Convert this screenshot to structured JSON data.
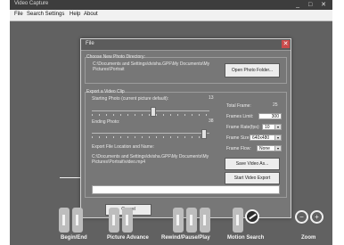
{
  "window": {
    "title": "Video Capture",
    "controls": "_ □ ✕"
  },
  "menu": {
    "file": "File",
    "search_settings": "Search Settings",
    "help": "Help",
    "about": "About"
  },
  "dialog": {
    "title": "File",
    "close_glyph": "✕",
    "photo_dir": {
      "label": "Choose New Photo Directory:",
      "path": "C:\\Documents and Settings\\dvisha.GPF\\My Documents\\My Pictures\\Portrait",
      "open_button": "Open Photo Folder..."
    },
    "video_clip": {
      "label": "Export a Video Clip",
      "start_label": "Starting Photo (current picture default):",
      "start_value": "13",
      "start_position": 0.52,
      "end_label": "Ending Photo:",
      "end_value": "38",
      "end_position": 0.98,
      "export_label": "Export File Location and Name:",
      "export_path": "C:\\Documents and Settings\\dvisha.GPF\\My Documents\\My Pictures\\Portrait\\video.mp4",
      "total_frames_label": "Total Frame:",
      "total_frames_value": "25",
      "frames_limit_label": "Frames Limit:",
      "frames_limit_value": "300",
      "frame_rate_label": "Frame Rate(fps):",
      "frame_rate_value": "10",
      "frame_size_label": "Frame Size:",
      "frame_size_value": "640x480",
      "frame_flow_label": "Frame Flow:",
      "frame_flow_value": "None",
      "save_button": "Save Video As...",
      "start_button": "Start Video Export",
      "cancel_button": "Cancel"
    }
  },
  "toolbar": {
    "begin_end": "Begin/End",
    "picture_advance": "Picture Advance",
    "rewind_pause_play": "Rewind/Pause/Play",
    "motion_search": "Motion Search",
    "zoom": "Zoom",
    "zoom_out_glyph": "−",
    "zoom_in_glyph": "+"
  }
}
